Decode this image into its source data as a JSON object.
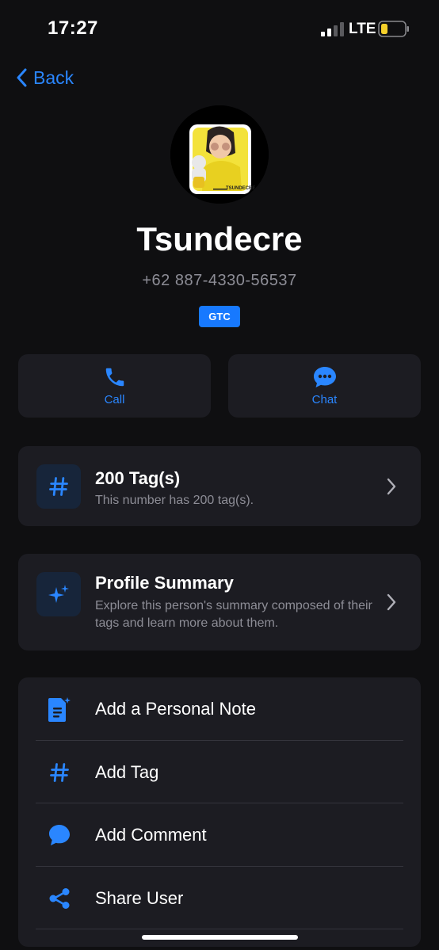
{
  "status_bar": {
    "time": "17:27",
    "network": "LTE"
  },
  "nav": {
    "back_label": "Back"
  },
  "profile": {
    "name": "Tsundecre",
    "phone": "+62 887-4330-56537",
    "badge": "GTC",
    "avatar_caption": "TSUNDECRE"
  },
  "actions": {
    "call_label": "Call",
    "chat_label": "Chat"
  },
  "tags_card": {
    "title": "200 Tag(s)",
    "subtitle": "This number has 200 tag(s)."
  },
  "summary_card": {
    "title": "Profile Summary",
    "subtitle": "Explore this person's summary composed of their tags and learn more about them."
  },
  "menu": {
    "items": [
      {
        "label": "Add a Personal Note",
        "icon": "note-icon"
      },
      {
        "label": "Add Tag",
        "icon": "hashtag-icon"
      },
      {
        "label": "Add Comment",
        "icon": "comment-icon"
      },
      {
        "label": "Share User",
        "icon": "share-icon"
      }
    ]
  },
  "colors": {
    "accent": "#2a86ff",
    "background": "#0f0f11",
    "card": "#1c1c22",
    "battery": "#f5d02a"
  }
}
